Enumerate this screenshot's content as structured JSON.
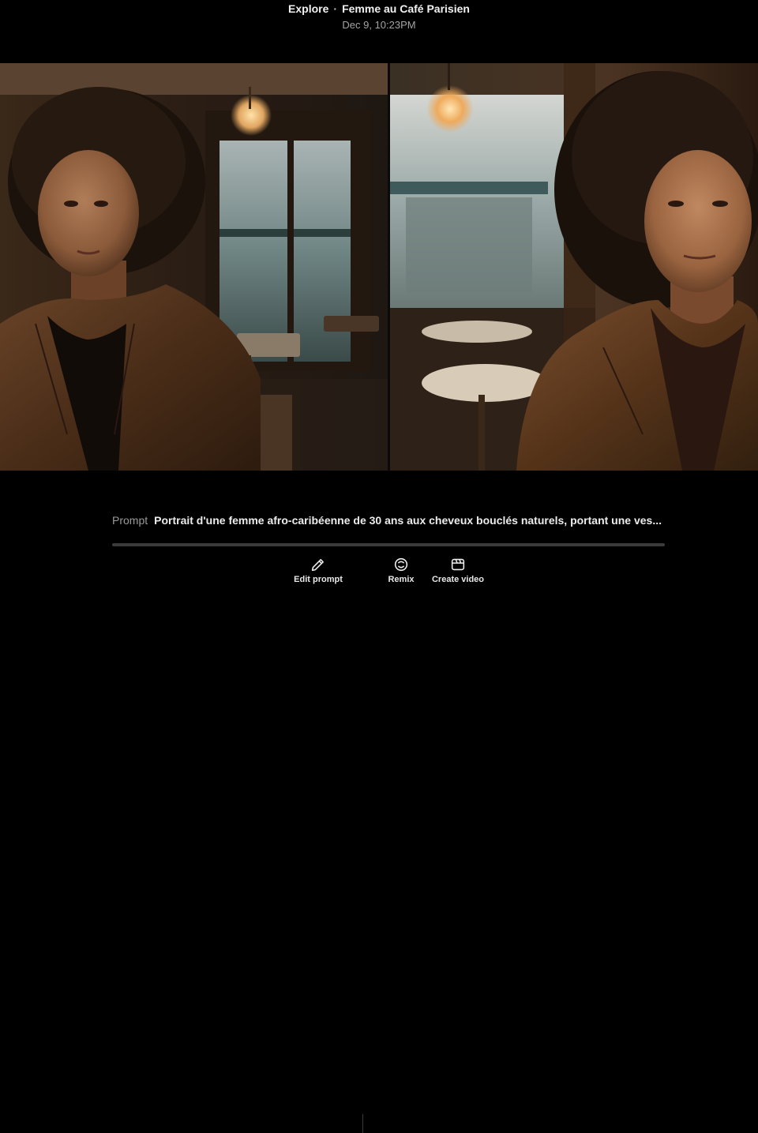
{
  "header": {
    "section": "Explore",
    "separator": "·",
    "title": "Femme au Café Parisien",
    "timestamp": "Dec 9, 10:23PM"
  },
  "prompt": {
    "label": "Prompt",
    "text": "Portrait d'une femme afro-caribéenne de 30 ans aux cheveux bouclés naturels, portant une ves..."
  },
  "actions": {
    "edit_prompt": {
      "label": "Edit prompt",
      "icon": "pencil-icon"
    },
    "remix": {
      "label": "Remix",
      "icon": "remix-icon"
    },
    "create_video": {
      "label": "Create video",
      "icon": "clapperboard-icon"
    }
  },
  "colors": {
    "background": "#000000",
    "title": "#f2f2f2",
    "muted": "#a5a5a5"
  }
}
